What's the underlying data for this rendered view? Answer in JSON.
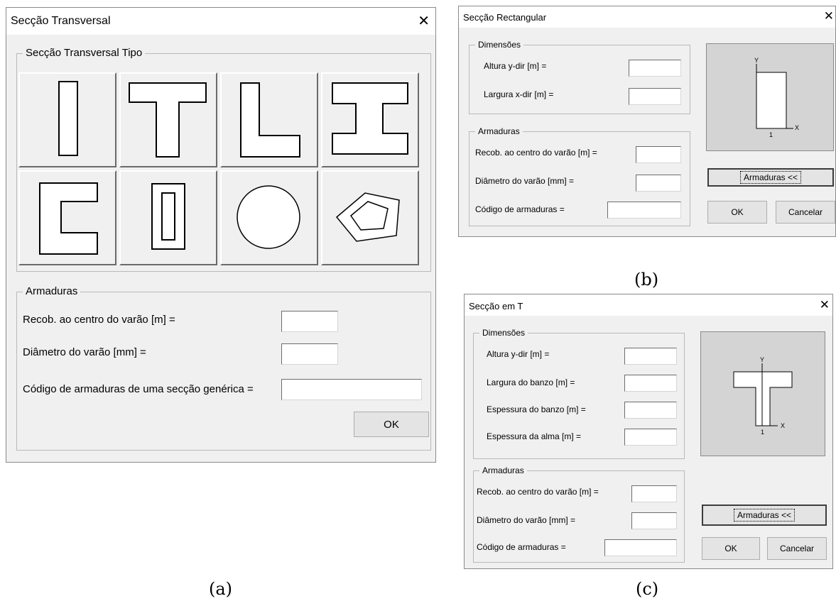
{
  "dialog_a": {
    "title": "Secção Transversal",
    "close_glyph": "✕",
    "group_tipo": "Secção Transversal Tipo",
    "shape_buttons": [
      "rectangle-section-icon",
      "t-section-icon",
      "l-section-icon",
      "i-section-icon",
      "c-section-icon",
      "hollow-rectangle-section-icon",
      "circular-section-icon",
      "polygonal-section-icon"
    ],
    "group_armaduras": "Armaduras",
    "recob_label": "Recob. ao centro do varão [m] =",
    "diametro_label": "Diâmetro do varão [mm] =",
    "codigo_label": "Código de armaduras de uma secção genérica =",
    "recob_value": "",
    "diametro_value": "",
    "codigo_value": "",
    "ok_label": "OK"
  },
  "dialog_b": {
    "title": "Secção Rectangular",
    "close_glyph": "✕",
    "group_dimensoes": "Dimensões",
    "altura_label": "Altura y-dir [m] =",
    "largura_label": "Largura x-dir [m] =",
    "group_armaduras": "Armaduras",
    "recob_label": "Recob. ao centro do varão [m] =",
    "diametro_label": "Diâmetro do varão [mm] =",
    "codigo_label": "Código de armaduras =",
    "altura_value": "",
    "largura_value": "",
    "recob_value": "",
    "diametro_value": "",
    "codigo_value": "",
    "axis_y": "Y",
    "axis_x": "X",
    "axis_origin": "1",
    "armaduras_button": "Armaduras <<",
    "ok_label": "OK",
    "cancel_label": "Cancelar"
  },
  "dialog_c": {
    "title": "Secção em T",
    "close_glyph": "✕",
    "group_dimensoes": "Dimensões",
    "altura_label": "Altura y-dir [m] =",
    "largura_banzo_label": "Largura do banzo [m] =",
    "espessura_banzo_label": "Espessura do banzo [m] =",
    "espessura_alma_label": "Espessura da alma [m] =",
    "group_armaduras": "Armaduras",
    "recob_label": "Recob. ao centro do varão [m] =",
    "diametro_label": "Diâmetro do varão [mm] =",
    "codigo_label": "Código de armaduras =",
    "altura_value": "",
    "largura_banzo_value": "",
    "espessura_banzo_value": "",
    "espessura_alma_value": "",
    "recob_value": "",
    "diametro_value": "",
    "codigo_value": "",
    "axis_y": "Y",
    "axis_x": "X",
    "axis_origin": "1",
    "armaduras_button": "Armaduras <<",
    "ok_label": "OK",
    "cancel_label": "Cancelar"
  },
  "captions": {
    "a": "(a)",
    "b": "(b)",
    "c": "(c)"
  }
}
